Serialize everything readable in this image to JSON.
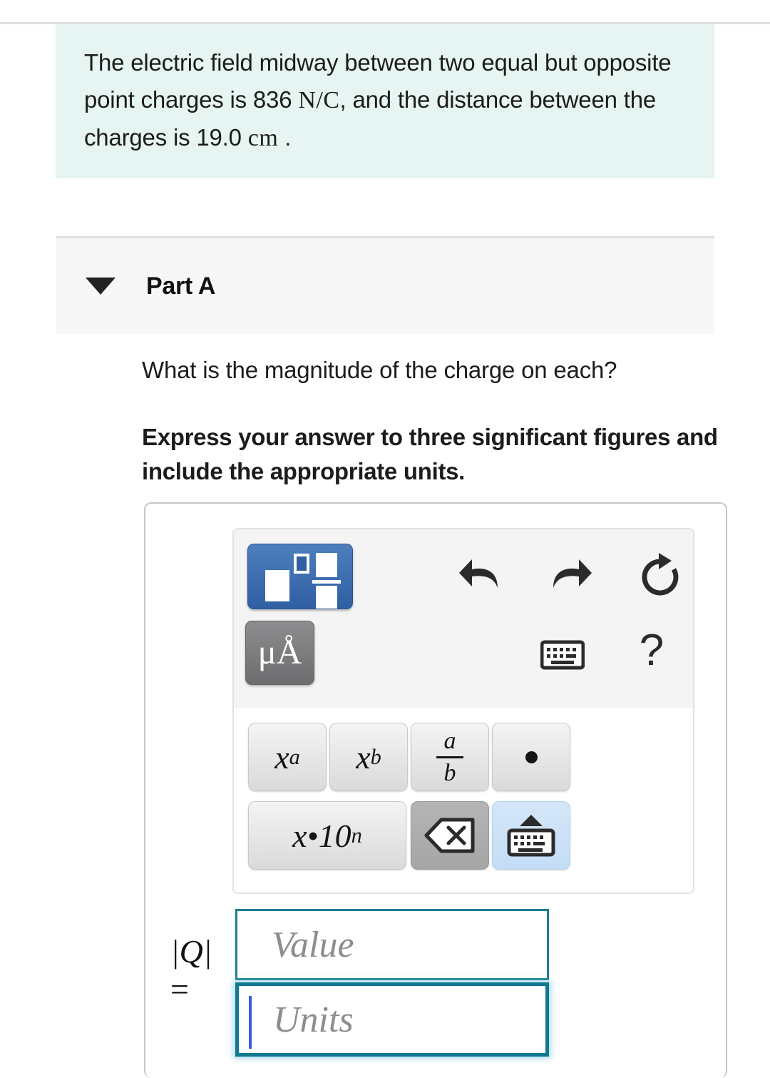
{
  "problem": {
    "text_part1": "The electric field midway between two equal but opposite point charges is 836",
    "unit_field": "N/C",
    "text_part2": ", and the distance between the charges is 19.0",
    "unit_distance": "cm",
    "text_part3": ".",
    "background_color": "#e6f4f2"
  },
  "part": {
    "title": "Part A",
    "caret_icon": "triangle-down-icon",
    "collapsed": false,
    "background_color": "#f7f7f7"
  },
  "question": {
    "prompt": "What is the magnitude of the charge on each?",
    "instruction": "Express your answer to three significant figures and include the appropriate units."
  },
  "toolbar": {
    "templates_button": {
      "name": "templates-button",
      "label": "",
      "color": "#2f5fa3",
      "selected": true
    },
    "units_button": {
      "name": "units-button",
      "label": "μÅ",
      "color": "#7b7b7d"
    },
    "undo_icon": "undo-icon",
    "redo_icon": "redo-icon",
    "reset_icon": "reset-icon",
    "keyboard_icon": "keyboard-icon",
    "help_icon": "help-icon",
    "help_label": "?",
    "keys": [
      {
        "name": "superscript-key",
        "label": "x",
        "script": "a",
        "type": "superscript"
      },
      {
        "name": "subscript-key",
        "label": "x",
        "script": "b",
        "type": "subscript"
      },
      {
        "name": "fraction-key",
        "numerator": "a",
        "denominator": "b",
        "type": "fraction"
      },
      {
        "name": "multiply-dot-key",
        "label": "•",
        "type": "dot"
      },
      {
        "name": "scientific-notation-key",
        "label": "x•10",
        "script": "n",
        "type": "superscript"
      },
      {
        "name": "backspace-key",
        "label": "",
        "type": "backspace"
      },
      {
        "name": "keyboard-toggle-key",
        "label": "",
        "type": "keyboard"
      }
    ]
  },
  "answer": {
    "label_symbol": "|Q|",
    "label_equals": "=",
    "value_field": {
      "name": "value-input",
      "value": "",
      "placeholder": "Value",
      "focused": false,
      "border_color": "#1b7e93"
    },
    "units_field": {
      "name": "units-input",
      "value": "",
      "placeholder": "Units",
      "focused": true,
      "border_color": "#10788f"
    }
  }
}
